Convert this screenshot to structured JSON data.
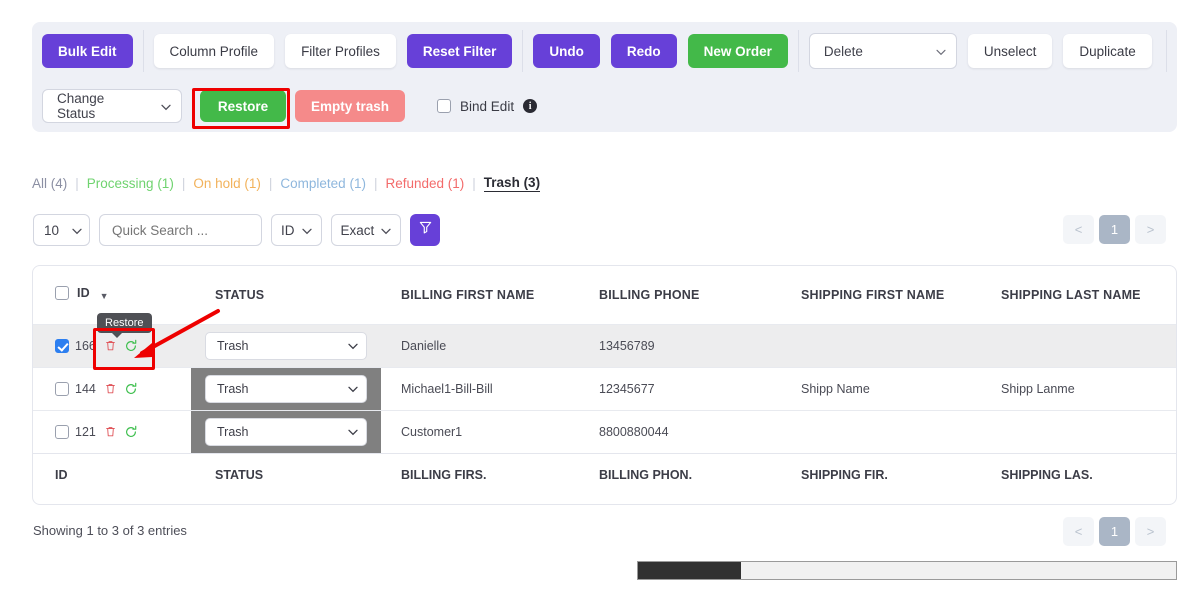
{
  "toolbar": {
    "row1": {
      "bulk_edit": "Bulk Edit",
      "column_profile": "Column Profile",
      "filter_profiles": "Filter Profiles",
      "reset_filter": "Reset Filter",
      "undo": "Undo",
      "redo": "Redo",
      "new_order": "New Order",
      "delete_select": "Delete",
      "unselect": "Unselect",
      "duplicate": "Duplicate"
    },
    "row2": {
      "change_status": "Change Status",
      "restore": "Restore",
      "empty_trash": "Empty trash",
      "bind_edit": "Bind Edit",
      "info_char": "i"
    },
    "colors": {
      "purple": "#6740d8",
      "green": "#43b949",
      "red": "#f58a8a",
      "panel_bg": "#eef0f6",
      "annotation": "#ee0000"
    }
  },
  "status_links": [
    {
      "label": "All (4)",
      "color": "#8b8fa3",
      "active": false
    },
    {
      "label": "Processing (1)",
      "color": "#6fd36f",
      "active": false
    },
    {
      "label": "On hold (1)",
      "color": "#f2b25b",
      "active": false
    },
    {
      "label": "Completed (1)",
      "color": "#8fb7dd",
      "active": false
    },
    {
      "label": "Refunded (1)",
      "color": "#f36b6b",
      "active": false
    },
    {
      "label": "Trash (3)",
      "color": "#2b2c34",
      "active": true
    }
  ],
  "separator": "|",
  "search": {
    "page_length": "10",
    "placeholder": "Quick Search ...",
    "column": "ID",
    "match_mode": "Exact",
    "filter_icon": "funnel-icon"
  },
  "pagination": {
    "prev": "<",
    "current": "1",
    "next": ">"
  },
  "table": {
    "headers": [
      "ID",
      "STATUS",
      "BILLING FIRST NAME",
      "BILLING PHONE",
      "SHIPPING FIRST NAME",
      "SHIPPING LAST NAME"
    ],
    "footers": [
      "ID",
      "STATUS",
      "BILLING FIRS.",
      "BILLING PHON.",
      "SHIPPING FIR.",
      "SHIPPING LAS."
    ],
    "rows": [
      {
        "id": "166",
        "selected": true,
        "status": "Trash",
        "billing_first_name": "Danielle",
        "billing_phone": "13456789",
        "shipping_first_name": "",
        "shipping_last_name": ""
      },
      {
        "id": "144",
        "selected": false,
        "status": "Trash",
        "billing_first_name": "Michael1-Bill-Bill",
        "billing_phone": "12345677",
        "shipping_first_name": "Shipp Name",
        "shipping_last_name": "Shipp Lanme"
      },
      {
        "id": "121",
        "selected": false,
        "status": "Trash",
        "billing_first_name": "Customer1",
        "billing_phone": "8800880044",
        "shipping_first_name": "",
        "shipping_last_name": ""
      }
    ],
    "row_icons": {
      "delete": "trash-icon",
      "restore": "restore-icon"
    }
  },
  "tooltip": {
    "text": "Restore"
  },
  "footer": {
    "showing": "Showing 1 to 3 of 3 entries"
  }
}
